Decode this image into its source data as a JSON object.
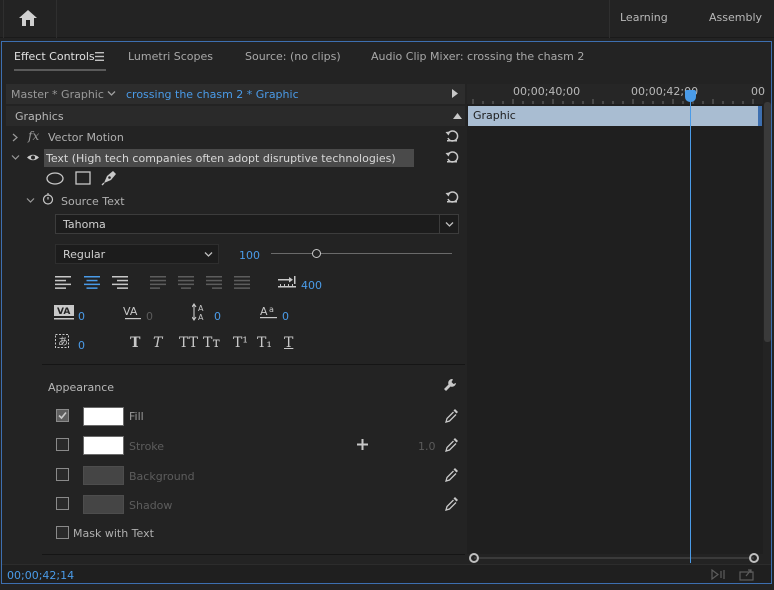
{
  "topbar": {
    "home_label": "home",
    "workspaces": [
      "Learning",
      "Assembly"
    ]
  },
  "tabs": {
    "effect_controls": "Effect Controls",
    "lumetri": "Lumetri Scopes",
    "source": "Source: (no clips)",
    "mixer": "Audio Clip Mixer: crossing the chasm 2"
  },
  "header": {
    "master": "Master * Graphic",
    "sequence": "crossing the chasm 2 * Graphic"
  },
  "timeline": {
    "time_a": "00;00;40;00",
    "time_b": "00;00;42;00",
    "time_c": "00",
    "clip_label": "Graphic",
    "playhead_fraction": 0.75
  },
  "effects": {
    "section": "Graphics",
    "fx_badge": "fx",
    "vector_motion": "Vector Motion",
    "text_layer": "Text (High tech companies often adopt disruptive technologies)",
    "source_text": "Source Text"
  },
  "text_props": {
    "font": "Tahoma",
    "style": "Regular",
    "size": "100",
    "size_slider_fraction": 0.25,
    "tab_width": "400",
    "kerning": "0",
    "tracking": "0",
    "leading": "0",
    "baseline": "0",
    "tsume": "0",
    "style_buttons": [
      "T",
      "T",
      "TT",
      "Tт",
      "T¹",
      "T₁",
      "T"
    ]
  },
  "appearance": {
    "title": "Appearance",
    "fill_label": "Fill",
    "fill_checked": true,
    "stroke_label": "Stroke",
    "stroke_width": "1.0",
    "background_label": "Background",
    "shadow_label": "Shadow",
    "mask_label": "Mask with Text"
  },
  "footer": {
    "timecode": "00;00;42;14"
  },
  "colors": {
    "accent": "#4a9be8",
    "panel_border": "#3d6fb0",
    "clip_fill": "#a9bdd2",
    "swatch_white": "#ffffff"
  }
}
